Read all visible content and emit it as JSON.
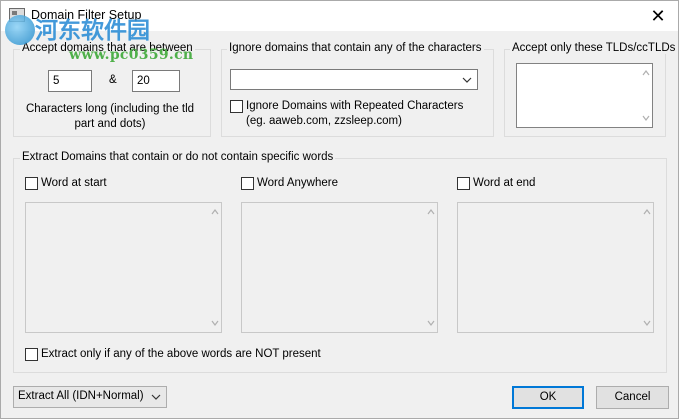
{
  "window": {
    "title": "Domain Filter Setup",
    "close_glyph": "✕"
  },
  "watermark": {
    "chinese": "河东软件园",
    "url": "www.pc0359.cn"
  },
  "length_group": {
    "label": "Accept domains that are between",
    "min_value": "5",
    "separator": "&",
    "max_value": "20",
    "note": "Characters long (including the tld part and dots)"
  },
  "ignore_group": {
    "label": "Ignore domains that contain any of the characters",
    "combo_value": "",
    "repeated_label": "Ignore Domains with Repeated Characters (eg. aaweb.com, zzsleep.com)"
  },
  "tld_group": {
    "label": "Accept only these TLDs/ccTLDs"
  },
  "words_group": {
    "label": "Extract Domains that contain or do not contain specific words",
    "start_label": "Word at start",
    "anywhere_label": "Word Anywhere",
    "end_label": "Word at end",
    "not_present_label": "Extract only if any of the above words are NOT present"
  },
  "footer": {
    "extract_mode": "Extract All (IDN+Normal)",
    "ok_label": "OK",
    "cancel_label": "Cancel"
  },
  "icons": [
    "app-icon",
    "close-icon",
    "chevron-down-icon",
    "scroll-up-arrow-icon",
    "scroll-down-arrow-icon"
  ]
}
